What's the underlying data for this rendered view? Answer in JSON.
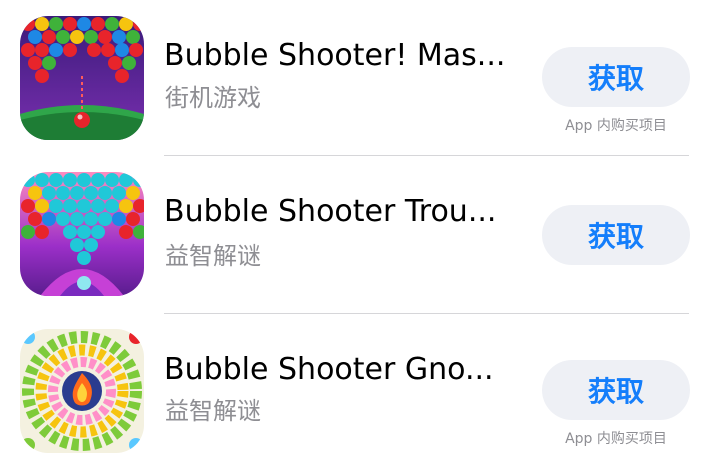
{
  "apps": [
    {
      "name": "Bubble Shooter! Mas...",
      "category": "街机游戏",
      "get_label": "获取",
      "iap_note": "App 内购买项目",
      "icon": "bubble-shooter-master-icon"
    },
    {
      "name": "Bubble Shooter Trou...",
      "category": "益智解谜",
      "get_label": "获取",
      "iap_note": "",
      "icon": "bubble-shooter-trouble-icon"
    },
    {
      "name": "Bubble Shooter Gno...",
      "category": "益智解谜",
      "get_label": "获取",
      "iap_note": "App 内购买项目",
      "icon": "bubble-shooter-gnome-icon"
    }
  ],
  "colors": {
    "accent": "#147efb",
    "button_bg": "#eef0f5",
    "secondary_text": "#8e8e93",
    "divider": "#d6d6d9"
  }
}
